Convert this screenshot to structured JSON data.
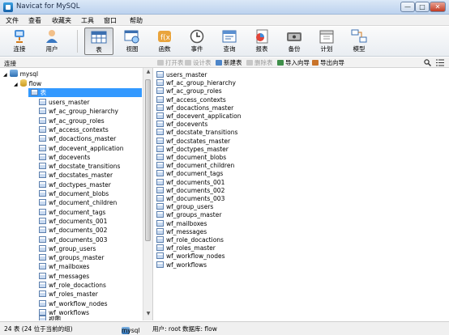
{
  "window": {
    "title": "Navicat for MySQL",
    "minimize": "—",
    "maximize": "□",
    "close": "✕"
  },
  "menu": [
    "文件",
    "查看",
    "收藏夹",
    "工具",
    "窗口",
    "帮助"
  ],
  "toolbar": {
    "connect": "连接",
    "user": "用户",
    "table": "表",
    "view": "视图",
    "function": "函数",
    "event": "事件",
    "query": "查询",
    "report": "报表",
    "backup": "备份",
    "schedule": "计划",
    "model": "模型"
  },
  "panel": {
    "connections_label": "连接"
  },
  "object_toolbar": {
    "open_table": "打开表",
    "design_table": "设计表",
    "new_table": "新建表",
    "delete_table": "删除表",
    "import_wizard": "导入向导",
    "export_wizard": "导出向导"
  },
  "tree": {
    "connection": "mysql",
    "database": "flow",
    "tables_node": "表",
    "partial_bottom": "视图"
  },
  "tables": [
    "users_master",
    "wf_ac_group_hierarchy",
    "wf_ac_group_roles",
    "wf_access_contexts",
    "wf_docactions_master",
    "wf_docevent_application",
    "wf_docevents",
    "wf_docstate_transitions",
    "wf_docstates_master",
    "wf_doctypes_master",
    "wf_document_blobs",
    "wf_document_children",
    "wf_document_tags",
    "wf_documents_001",
    "wf_documents_002",
    "wf_documents_003",
    "wf_group_users",
    "wf_groups_master",
    "wf_mailboxes",
    "wf_messages",
    "wf_role_docactions",
    "wf_roles_master",
    "wf_workflow_nodes",
    "wf_workflows"
  ],
  "status": {
    "count": "24 表 (24 位于当前的组)",
    "connection": "mysql",
    "user": "用户: root",
    "database": "数据库: flow"
  }
}
